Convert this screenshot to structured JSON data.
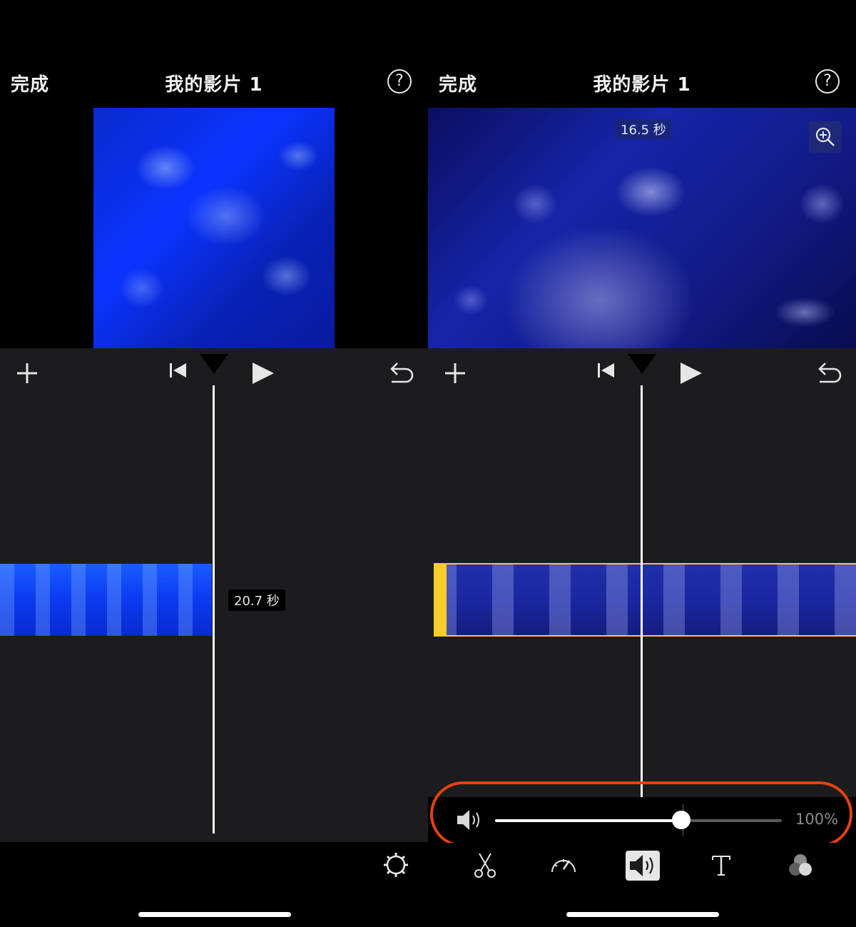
{
  "left_panel": {
    "header": {
      "done_label": "完成",
      "title": "我的影片 1",
      "help_glyph": "?"
    },
    "clip": {
      "duration_label": "20.7 秒"
    },
    "icons": [
      "add-icon",
      "rewind-to-start-icon",
      "play-icon",
      "undo-icon",
      "settings-gear-icon"
    ]
  },
  "right_panel": {
    "header": {
      "done_label": "完成",
      "title": "我的影片 1",
      "help_glyph": "?"
    },
    "preview": {
      "duration_label": "16.5 秒"
    },
    "volume": {
      "level_percent": 65,
      "label": "100%"
    },
    "tools": [
      {
        "name": "split-scissors-icon",
        "active": false
      },
      {
        "name": "speed-icon",
        "active": false
      },
      {
        "name": "volume-icon",
        "active": true
      },
      {
        "name": "title-text-icon",
        "active": false
      },
      {
        "name": "filter-icon",
        "active": false
      }
    ],
    "colors": {
      "selection": "#f8cc2a",
      "highlight_ring": "#e8410f"
    }
  }
}
